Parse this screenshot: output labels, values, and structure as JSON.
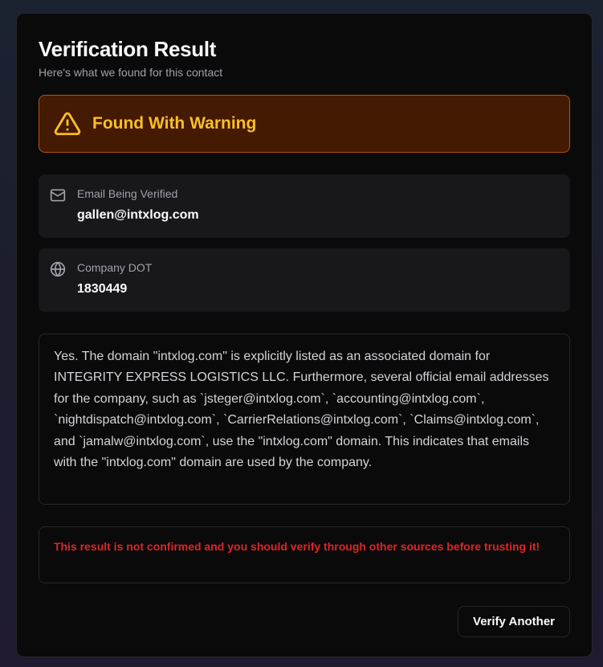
{
  "header": {
    "title": "Verification Result",
    "subtitle": "Here's what we found for this contact"
  },
  "status": {
    "label": "Found With Warning",
    "icon": "warning-triangle-icon",
    "accent_color": "#fbbf24",
    "background_color": "#451a03",
    "border_color": "#b45309"
  },
  "email": {
    "icon": "mail-icon",
    "label": "Email Being Verified",
    "value": "gallen@intxlog.com"
  },
  "company": {
    "icon": "globe-icon",
    "label": "Company DOT",
    "value": "1830449"
  },
  "explanation": {
    "text": "Yes. The domain \"intxlog.com\" is explicitly listed as an associated domain for INTEGRITY EXPRESS LOGISTICS LLC. Furthermore, several official email addresses for the company, such as `jsteger@intxlog.com`, `accounting@intxlog.com`, `nightdispatch@intxlog.com`, `CarrierRelations@intxlog.com`, `Claims@intxlog.com`, and `jamalw@intxlog.com`, use the \"intxlog.com\" domain. This indicates that emails with the \"intxlog.com\" domain are used by the company."
  },
  "disclaimer": {
    "text": "This result is not confirmed and you should verify through other sources before trusting it!",
    "color": "#dc2626"
  },
  "actions": {
    "verify_another_label": "Verify Another"
  }
}
